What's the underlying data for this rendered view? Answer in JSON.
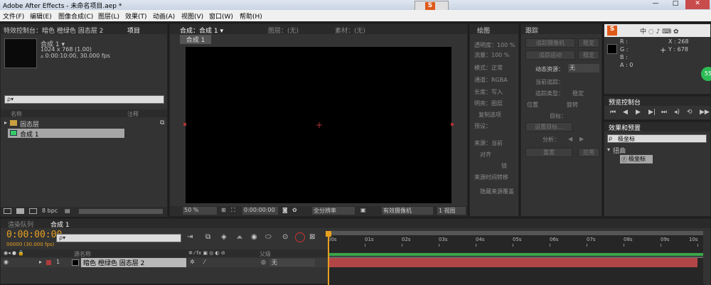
{
  "app": {
    "title": "Adobe After Effects - 未命名项目.aep *",
    "window_controls": {
      "minimize": "—",
      "maximize": "□",
      "close": "✕"
    }
  },
  "menu": [
    "文件(F)",
    "编辑(E)",
    "图像合成(C)",
    "图层(L)",
    "效果(T)",
    "动画(A)",
    "视图(V)",
    "窗口(W)",
    "帮助(H)"
  ],
  "project_panel": {
    "tabs": [
      "特效控制台：暗色 橙绿色 固态层 2",
      "项目"
    ],
    "preview_name": "合成 1 ▾",
    "preview_info": [
      "1024 x 768 (1.00)",
      "▵ 0:00:10:00, 30.000 fps"
    ],
    "search_placeholder": "ρ▾",
    "col_name": "名称",
    "col_comment": "注释",
    "items": [
      {
        "label": "固态层",
        "type": "folder"
      },
      {
        "label": "合成 1",
        "type": "comp"
      }
    ],
    "bpc": "8 bpc"
  },
  "comp_panel": {
    "tabs": [
      "合成：合成 1 ▾",
      "图层：(无)",
      "素材：(无)"
    ],
    "subtab": "合成 1",
    "zoom": "50 %",
    "timecode": "0:00:00:00",
    "resolution": "全分辨率",
    "camera": "有效摄像机",
    "views": "1 视图"
  },
  "paint_panel": {
    "tab": "绘图",
    "lines": [
      "透明度：100 %",
      "流量：100 %",
      "模式：正常",
      "通道：RGBA",
      "长度：写入",
      "明亮：图层",
      "复制选项",
      "预设：",
      "来源：当前",
      "对齐",
      "锁",
      "来源时间转移",
      "隐藏来源覆盖"
    ]
  },
  "tracker_panel": {
    "tab": "跟踪",
    "buttons": [
      "追踪摄像机",
      "稳定",
      "追踪运动",
      "稳定"
    ],
    "motion_source_label": "动态资源：",
    "motion_source_value": "无",
    "current_track_label": "当前追踪：",
    "track_type_label": "追踪类型：",
    "track_type_value": "稳定",
    "checks": [
      "位置",
      "旋转"
    ],
    "target_label": "目标：",
    "set_target": "设置目标...",
    "analyze_label": "分析：",
    "reset": "重置",
    "apply": "应用"
  },
  "info_panel": {
    "labels": [
      "R :",
      "G :",
      "B :",
      "A : 0"
    ],
    "x": "X : 268",
    "y": "Y : 678",
    "badge": "55"
  },
  "preview_panel": {
    "tab": "预览控制台",
    "controls": [
      "first",
      "prev",
      "play",
      "next",
      "last",
      "audio",
      "loop",
      "ram"
    ]
  },
  "effects_panel": {
    "tab": "效果和预置",
    "search_value": "极坐标",
    "category": "扭曲",
    "effect": "极坐标"
  },
  "timeline": {
    "tabs": [
      "渲染队列",
      "合成 1"
    ],
    "timecode": "0:00:00:00",
    "frame_info": "00000 (30.000 fps)",
    "search_placeholder": "ρ▾",
    "ticks": [
      "00s",
      "01s",
      "02s",
      "03s",
      "04s",
      "05s",
      "06s",
      "07s",
      "08s",
      "09s",
      "10s"
    ],
    "col_layer_name": "源名称",
    "col_parent": "父级",
    "layer": {
      "index": "1",
      "name": "暗色 橙绿色 固态层 2",
      "parent": "无",
      "color": "#b13a3a"
    }
  },
  "ime_bar": {
    "label": "S"
  },
  "colors": {
    "panel": "#333333",
    "comp_bg": "#000000",
    "accent_orange": "#e8a020",
    "layer_bar": "#b24646",
    "work_area": "#3aa64a"
  }
}
